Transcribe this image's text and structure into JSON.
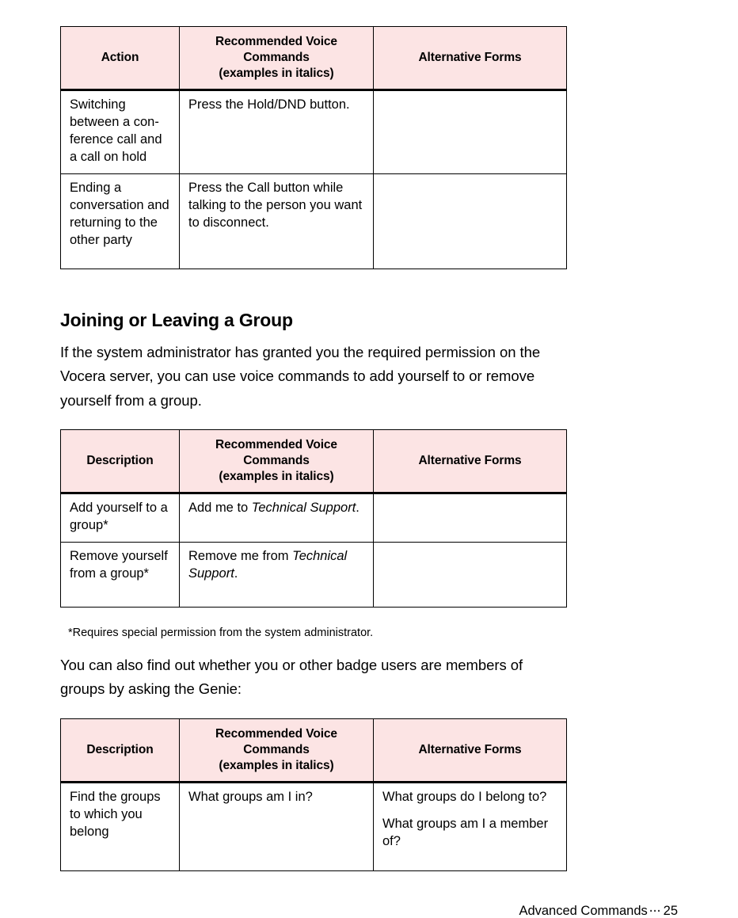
{
  "page": {
    "footer": {
      "section_label": "Advanced Commands",
      "separator": "⋯",
      "page_number": "25"
    },
    "accent_header_bg": "#fce4e4",
    "text_color": "#000000"
  },
  "tables": [
    {
      "id": "table-hold-dnd",
      "headers": {
        "col1": "Action",
        "col2_line1": "Recommended Voice",
        "col2_line2": "Commands",
        "col2_line3": "(examples in italics)",
        "col3": "Alternative Forms"
      },
      "rows": [
        {
          "description": "Switching between a con-ference call and a call on hold",
          "command": "Press the Hold/DND button.",
          "alternatives": ""
        },
        {
          "description": "Ending a conversation and returning to the other party",
          "command": "Press the Call button while talking to the person you want to disconnect.",
          "alternatives": ""
        }
      ]
    },
    {
      "id": "table-group-membership",
      "headers": {
        "col1": "Description",
        "col2_line1": "Recommended Voice",
        "col2_line2": "Commands",
        "col2_line3": "(examples in italics)",
        "col3": "Alternative Forms"
      },
      "rows": [
        {
          "description": "Add yourself to a group*",
          "command_prefix": "Add me to ",
          "command_italic": "Technical Support",
          "command_suffix": ".",
          "alternatives": ""
        },
        {
          "description": "Remove yourself from a group*",
          "command_prefix": "Remove me from ",
          "command_italic": "Technical Support",
          "command_suffix": ".",
          "alternatives": ""
        }
      ]
    },
    {
      "id": "table-group-query",
      "headers": {
        "col1": "Description",
        "col2_line1": "Recommended Voice",
        "col2_line2": "Commands",
        "col2_line3": "(examples in italics)",
        "col3": "Alternative Forms"
      },
      "rows": [
        {
          "description": "Find the groups to which you belong",
          "command": "What groups am I in?",
          "alternative_1": "What groups do I belong to?",
          "alternative_2": "What groups am I a member of?"
        }
      ]
    }
  ],
  "content": {
    "section_heading": "Joining or Leaving a Group",
    "intro_paragraph": "If the system administrator has granted you the required permission on the Vocera server, you can use voice commands to add yourself to or remove yourself from a group.",
    "footnote": "*Requires special permission from the system administrator.",
    "genie_paragraph": "You can also find out whether you or other badge users are members of groups by asking the Genie:"
  }
}
